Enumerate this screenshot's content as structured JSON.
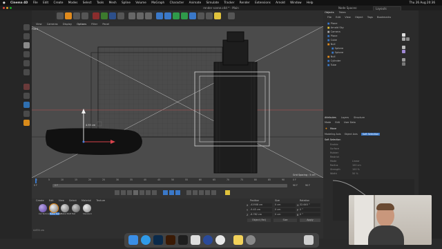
{
  "menubar": {
    "items": [
      "Cinema 4D",
      "File",
      "Edit",
      "Create",
      "Modes",
      "Select",
      "Tools",
      "Mesh",
      "Spline",
      "Volume",
      "MoGraph",
      "Character",
      "Animate",
      "Simulate",
      "Tracker",
      "Render",
      "Extensions",
      "Arnold",
      "Window",
      "Help"
    ],
    "clock": "Thu 26 Aug 20:36"
  },
  "window": {
    "title": "render scene.c4d * - Main",
    "layout_label": "Node Spaces:",
    "layout_value": "Layouts"
  },
  "viewport": {
    "menu": [
      "View",
      "Cameras",
      "Display",
      "Options",
      "Filter",
      "Panel"
    ],
    "label": "Front",
    "grid_spacing": "Grid Spacing : 5 cm",
    "measure": "4.95 cm"
  },
  "timeline": {
    "ticks": [
      "0",
      "5",
      "10",
      "15",
      "20",
      "25",
      "30",
      "35",
      "40",
      "45",
      "50",
      "55",
      "60",
      "65",
      "70",
      "75",
      "80",
      "85",
      "90"
    ],
    "start": "0 F",
    "current": "0 F",
    "end_a": "90 F",
    "end_b": "90 F",
    "frame": "0 F"
  },
  "materials": {
    "menu": [
      "Create",
      "Edit",
      "View",
      "Select",
      "Material",
      "Texture"
    ],
    "items": [
      "Cel Texture",
      "Metal Textur",
      "Metal Matt",
      "Mat",
      "Standard"
    ]
  },
  "coords": {
    "headers": [
      "Position",
      "Size",
      "Rotation"
    ],
    "rows": [
      {
        "axis": "X",
        "pos": "-41908 cm",
        "size": "0 cm",
        "rot_label": "H",
        "rot": "32.645 °"
      },
      {
        "axis": "Y",
        "pos": "-9.45 cm",
        "size": "0 cm",
        "rot_label": "P",
        "rot": "0 °"
      },
      {
        "axis": "Z",
        "pos": "-8.782 cm",
        "size": "0 cm",
        "rot_label": "B",
        "rot": "0 °"
      }
    ],
    "mode": "Object (Rel)",
    "size_mode": "Size",
    "apply": "Apply"
  },
  "objects": {
    "tabs": [
      "Objects",
      "Takes"
    ],
    "menu": [
      "File",
      "Edit",
      "View",
      "Object",
      "Tags",
      "Bookmarks"
    ],
    "items": [
      "Plane",
      "Arnold Sky",
      "Camera",
      "Plane",
      "Cube",
      "Null",
      "Sphere",
      "Sphere",
      "Null",
      "Cylinder",
      "Tube"
    ]
  },
  "attributes": {
    "tabs": [
      "Attributes",
      "Layers",
      "Structure"
    ],
    "menu": [
      "Mode",
      "Edit",
      "User Data"
    ],
    "title": "Move",
    "subtabs": [
      "Modeling Axis",
      "Object Axis",
      "Soft Selection"
    ],
    "section": "Soft Selection",
    "fields": [
      "Enable",
      "Surface",
      "Rubber",
      "Restrict",
      "Mode",
      "Radius",
      "Strength",
      "Width"
    ],
    "field_values": [
      "",
      "",
      "",
      "",
      "Linear",
      "100 cm",
      "100 %",
      "50 %"
    ]
  },
  "status": "4.874 cm",
  "dock": [
    "Finder",
    "Safari",
    "Photoshop",
    "Illustrator",
    "Figma",
    "Preview",
    "Cinema 4D",
    "Chrome",
    "Notes",
    "Settings",
    "Trash"
  ],
  "colors": {
    "accent": "#e08a1c",
    "axis_red": "#d8434c",
    "axis_green": "#5fbf3f",
    "axis_blue": "#4a7cd6",
    "selection_blue": "#3a78c8"
  }
}
